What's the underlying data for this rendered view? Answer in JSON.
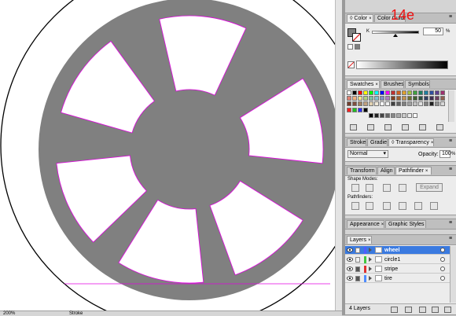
{
  "canvas": {
    "background": "#ffffff",
    "wheel_color": "#808080",
    "selection_color": "#e000e0",
    "overlay_label": "14e",
    "overlay_color": "#ee1111"
  },
  "status": {
    "zoom_text": "200%",
    "toggle_text": "Stroke"
  },
  "color_panel": {
    "tabs": [
      "Color",
      "Color Guide"
    ],
    "channel_label": "K",
    "channel_value": "50",
    "channel_unit": "%",
    "k_percent": 50
  },
  "swatches_panel": {
    "tabs": [
      "Swatches",
      "Brushes",
      "Symbols"
    ]
  },
  "transparency_panel": {
    "tabs": [
      "Stroke",
      "Gradient",
      "Transparency"
    ],
    "blend_mode": "Normal",
    "opacity_label": "Opacity:",
    "opacity_value": "100",
    "opacity_unit": "%"
  },
  "pathfinder_panel": {
    "tabs": [
      "Transform",
      "Align",
      "Pathfinder"
    ],
    "shape_modes_label": "Shape Modes:",
    "expand_label": "Expand",
    "pathfinders_label": "Pathfinders:"
  },
  "appearance_panel": {
    "tabs": [
      "Appearance",
      "Graphic Styles"
    ]
  },
  "layers_panel": {
    "tabs": [
      "Layers"
    ],
    "layers": [
      {
        "name": "wheel",
        "color": "#4f5cff",
        "selected": true,
        "locked": false
      },
      {
        "name": "circle1",
        "color": "#40c840",
        "selected": false,
        "locked": false
      },
      {
        "name": "stripe",
        "color": "#e03030",
        "selected": false,
        "locked": true
      },
      {
        "name": "tire",
        "color": "#4f8cff",
        "selected": false,
        "locked": true
      }
    ],
    "footer_count": "4 Layers"
  }
}
